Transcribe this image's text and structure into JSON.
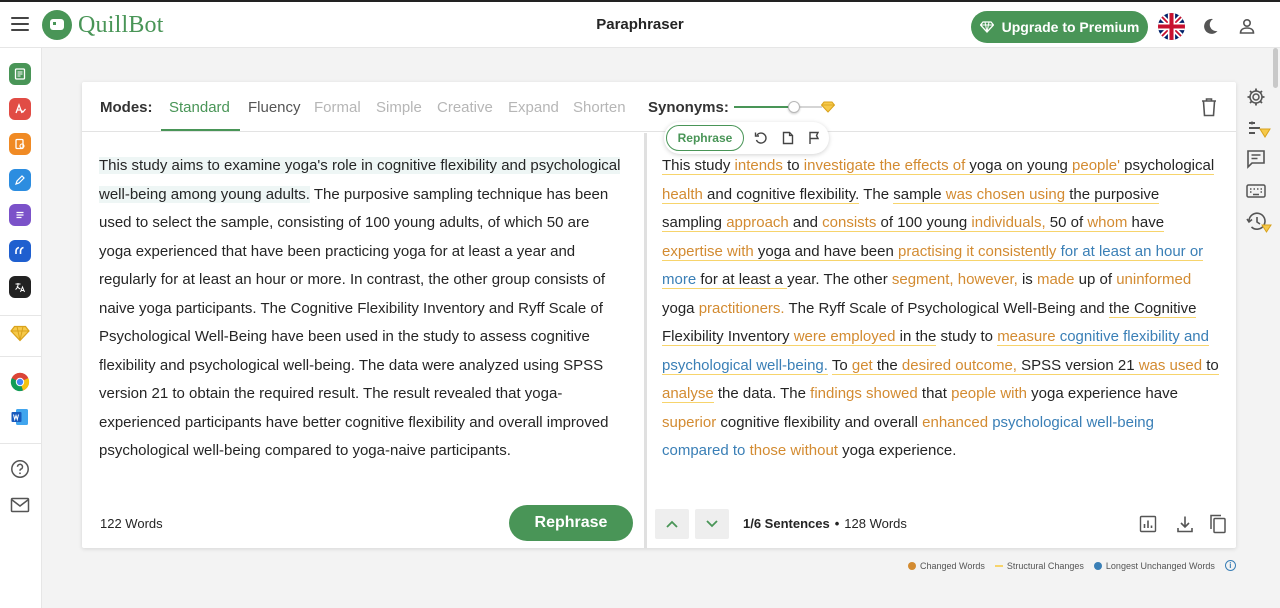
{
  "app": {
    "logo_text": "QuillBot",
    "page_title": "Paraphraser",
    "premium_label": "Upgrade to Premium"
  },
  "modes": {
    "label": "Modes:",
    "items": [
      "Standard",
      "Fluency",
      "Formal",
      "Simple",
      "Creative",
      "Expand",
      "Shorten"
    ],
    "active": "Standard",
    "synonyms_label": "Synonyms:",
    "synonyms_level": 0.7
  },
  "input": {
    "highlighted_sentence": "This study aims to examine yoga's role in cognitive flexibility and psychological well-being among young adults.",
    "rest_text": " The purposive sampling technique has been used to select the sample, consisting of 100 young adults, of which 50 are yoga experienced that have been practicing yoga for at least a year and regularly for at least an hour or more. In contrast, the other group consists of naive yoga participants. The Cognitive Flexibility Inventory and Ryff Scale of Psychological Well-Being have been used in the study to assess cognitive flexibility and psychological well-being. The data were analyzed using SPSS version 21 to obtain the required result. The result revealed that yoga-experienced participants have better cognitive flexibility and overall improved psychological well-being compared to yoga-naive participants.",
    "word_count": "122 Words",
    "rephrase_label": "Rephrase"
  },
  "popup": {
    "rephrase_label": "Rephrase"
  },
  "output": {
    "segments": [
      {
        "t": "This study ",
        "k": "n",
        "s": 1
      },
      {
        "t": "intends",
        "k": "c",
        "s": 1
      },
      {
        "t": " to ",
        "k": "n",
        "s": 1
      },
      {
        "t": "investigate the effects of",
        "k": "c",
        "s": 1
      },
      {
        "t": " yoga on ",
        "k": "n",
        "s": 1
      },
      {
        "t": "young",
        "k": "n",
        "s": 1
      },
      {
        "t": " ",
        "k": "n",
        "s": 1
      },
      {
        "t": "people'",
        "k": "c",
        "s": 1
      },
      {
        "t": " psychological ",
        "k": "n",
        "s": 1
      },
      {
        "t": "health",
        "k": "c",
        "s": 1
      },
      {
        "t": " and cognitive flexibility.",
        "k": "n",
        "s": 1
      },
      {
        "t": " The ",
        "k": "n",
        "s": 0
      },
      {
        "t": "sample ",
        "k": "n",
        "s": 1
      },
      {
        "t": "was chosen using",
        "k": "c",
        "s": 1
      },
      {
        "t": " the purposive sampling ",
        "k": "n",
        "s": 1
      },
      {
        "t": "approach",
        "k": "c",
        "s": 1
      },
      {
        "t": " and ",
        "k": "n",
        "s": 1
      },
      {
        "t": "consists",
        "k": "c",
        "s": 1
      },
      {
        "t": " of 100 young ",
        "k": "n",
        "s": 1
      },
      {
        "t": "individuals,",
        "k": "c",
        "s": 1
      },
      {
        "t": " 50 of ",
        "k": "n",
        "s": 1
      },
      {
        "t": "whom",
        "k": "c",
        "s": 1
      },
      {
        "t": " have ",
        "k": "n",
        "s": 1
      },
      {
        "t": "expertise with",
        "k": "c",
        "s": 1
      },
      {
        "t": " yoga and have been ",
        "k": "n",
        "s": 1
      },
      {
        "t": "practising it consistently",
        "k": "c",
        "s": 1
      },
      {
        "t": " ",
        "k": "n",
        "s": 1
      },
      {
        "t": "for at least an hour or more",
        "k": "u",
        "s": 1
      },
      {
        "t": " for at least a ",
        "k": "n",
        "s": 1
      },
      {
        "t": "year. ",
        "k": "n",
        "s": 0
      },
      {
        "t": "The other ",
        "k": "n",
        "s": 0
      },
      {
        "t": "segment, however,",
        "k": "c",
        "s": 0
      },
      {
        "t": " is ",
        "k": "n",
        "s": 0
      },
      {
        "t": "made",
        "k": "c",
        "s": 0
      },
      {
        "t": " up of ",
        "k": "n",
        "s": 0
      },
      {
        "t": "uninformed",
        "k": "c",
        "s": 0
      },
      {
        "t": " yoga ",
        "k": "n",
        "s": 0
      },
      {
        "t": "practitioners.",
        "k": "c",
        "s": 0
      },
      {
        "t": " The Ryff Scale of Psychological Well-Being and ",
        "k": "n",
        "s": 0
      },
      {
        "t": "the Cognitive Flexibility Inventory ",
        "k": "n",
        "s": 1
      },
      {
        "t": "were employed",
        "k": "c",
        "s": 1
      },
      {
        "t": " in the",
        "k": "n",
        "s": 1
      },
      {
        "t": " study to ",
        "k": "n",
        "s": 0
      },
      {
        "t": "measure",
        "k": "c",
        "s": 1
      },
      {
        "t": " ",
        "k": "n",
        "s": 1
      },
      {
        "t": "cognitive flexibility and psychological well-being.",
        "k": "u",
        "s": 1
      },
      {
        "t": " ",
        "k": "n",
        "s": 0
      },
      {
        "t": "To ",
        "k": "n",
        "s": 1
      },
      {
        "t": "get",
        "k": "c",
        "s": 1
      },
      {
        "t": " the ",
        "k": "n",
        "s": 1
      },
      {
        "t": "desired outcome,",
        "k": "c",
        "s": 1
      },
      {
        "t": " SPSS version 21 ",
        "k": "n",
        "s": 1
      },
      {
        "t": "was used",
        "k": "c",
        "s": 1
      },
      {
        "t": " to ",
        "k": "n",
        "s": 1
      },
      {
        "t": "analyse",
        "k": "c",
        "s": 1
      },
      {
        "t": " the data. The ",
        "k": "n",
        "s": 0
      },
      {
        "t": "findings showed",
        "k": "c",
        "s": 0
      },
      {
        "t": " that ",
        "k": "n",
        "s": 0
      },
      {
        "t": "people with",
        "k": "c",
        "s": 0
      },
      {
        "t": " yoga experience have ",
        "k": "n",
        "s": 0
      },
      {
        "t": "superior",
        "k": "c",
        "s": 0
      },
      {
        "t": " cognitive flexibility and overall ",
        "k": "n",
        "s": 0
      },
      {
        "t": "enhanced",
        "k": "c",
        "s": 0
      },
      {
        "t": " ",
        "k": "n",
        "s": 0
      },
      {
        "t": "psychological well-being compared to",
        "k": "u",
        "s": 0
      },
      {
        "t": " ",
        "k": "n",
        "s": 0
      },
      {
        "t": "those without",
        "k": "c",
        "s": 0
      },
      {
        "t": " yoga experience.",
        "k": "n",
        "s": 0
      }
    ],
    "sentence_position": "1/6 Sentences",
    "separator": "•",
    "word_count": "128 Words"
  },
  "legend": {
    "changed": "Changed Words",
    "structural": "Structural Changes",
    "unchanged": "Longest Unchanged Words",
    "info": "i"
  },
  "colors": {
    "brand": "#499557",
    "changed": "#d38b31",
    "structural": "#f7d46c",
    "unchanged": "#3a7fb6"
  }
}
